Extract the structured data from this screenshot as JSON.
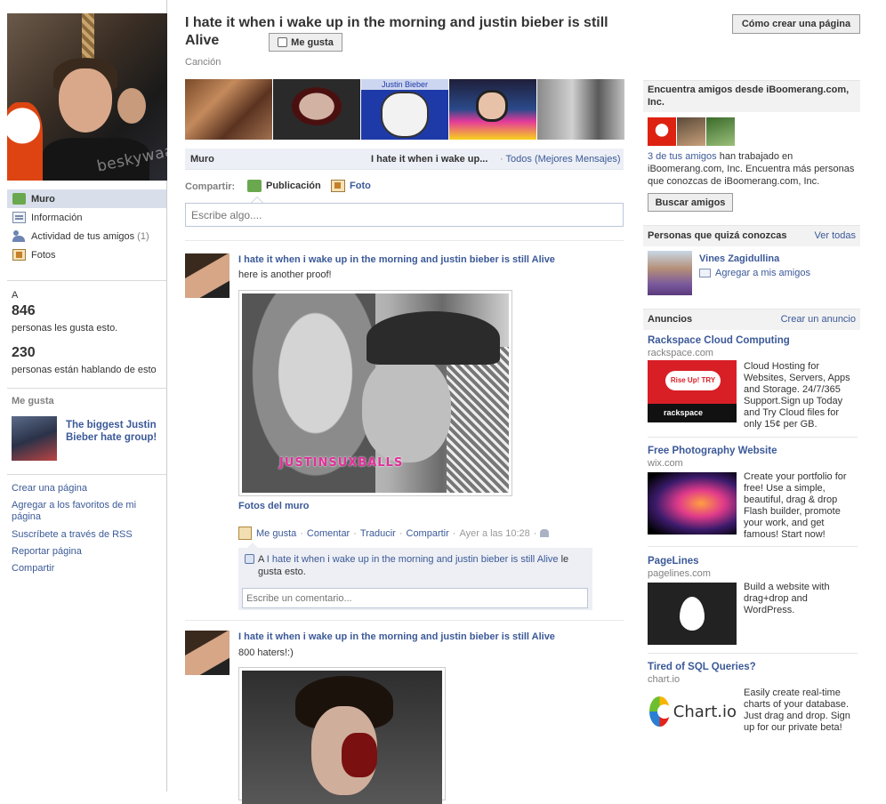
{
  "page": {
    "title": "I hate it when i wake up in the morning and justin bieber is still Alive",
    "like_button": "Me gusta",
    "category": "Canción",
    "create_page_button": "Cómo crear una página",
    "profile_watermark": "beskywaabbit"
  },
  "left_nav": {
    "items": [
      {
        "label": "Muro",
        "icon": "wall-icon",
        "active": true
      },
      {
        "label": "Información",
        "icon": "info-icon"
      },
      {
        "label": "Actividad de tus amigos",
        "count": "(1)",
        "icon": "friends-icon"
      },
      {
        "label": "Fotos",
        "icon": "photos-icon"
      }
    ]
  },
  "stats": {
    "prefix": "A",
    "likes_count": "846",
    "likes_label": "personas les gusta esto.",
    "talking_count": "230",
    "talking_label": "personas están hablando de esto"
  },
  "likes_section": {
    "title": "Me gusta",
    "item_name": "The biggest Justin Bieber hate group!"
  },
  "side_links": [
    "Crear una página",
    "Agregar a los favoritos de mi página",
    "Suscríbete a través de RSS",
    "Reportar página",
    "Compartir"
  ],
  "photo_strip": {
    "center_caption": "Justin Bieber"
  },
  "wall_tabs": {
    "muro": "Muro",
    "filter_title": "I hate it when i wake up...",
    "filter_sep": "·",
    "filter_links": "Todos (Mejores Mensajes)"
  },
  "composer": {
    "share_label": "Compartir:",
    "publication": "Publicación",
    "photo": "Foto",
    "placeholder": "Escribe algo...."
  },
  "posts": [
    {
      "author": "I hate it when i wake up in the morning and justin bieber is still Alive",
      "text": "here is another proof!",
      "photo_watermark": "JUSTINSUXBALLS",
      "album_link": "Fotos del muro",
      "actions": {
        "like": "Me gusta",
        "comment": "Comentar",
        "translate": "Traducir",
        "share": "Compartir",
        "time": "Ayer a las 10:28",
        "sep": "·"
      },
      "likes_prefix": "A",
      "likes_link": "I hate it when i wake up in the morning and justin bieber is still Alive",
      "likes_suffix": "le gusta esto.",
      "comment_placeholder": "Escribe un comentario..."
    },
    {
      "author": "I hate it when i wake up in the morning and justin bieber is still Alive",
      "text": "800 haters!:)"
    }
  ],
  "right": {
    "find_friends": {
      "title": "Encuentra amigos desde iBoomerang.com, Inc.",
      "desc_link": "3 de tus amigos",
      "desc_rest": "han trabajado en iBoomerang.com, Inc. Encuentra más personas que conozcas de iBoomerang.com, Inc.",
      "button": "Buscar amigos"
    },
    "pymk": {
      "title": "Personas que quizá conozcas",
      "see_all": "Ver todas",
      "name": "Vines Zagidullina",
      "add": "Agregar a mis amigos"
    },
    "ads": {
      "title": "Anuncios",
      "create": "Crear un anuncio",
      "items": [
        {
          "title": "Rackspace Cloud Computing",
          "domain": "rackspace.com",
          "body": "Cloud Hosting for Websites, Servers, Apps and Storage. 24/7/365 Support.Sign up Today and Try Cloud files for only 15¢ per GB.",
          "img_text1": "Rise Up! TRY TODAY!",
          "img_text2": "rackspace"
        },
        {
          "title": "Free Photography Website",
          "domain": "wix.com",
          "body": "Create your portfolio for free! Use a simple, beautiful, drag & drop Flash builder, promote your work, and get famous! Start now!"
        },
        {
          "title": "PageLines",
          "domain": "pagelines.com",
          "body": "Build a website with drag+drop and WordPress."
        },
        {
          "title": "Tired of SQL Queries?",
          "domain": "chart.io",
          "body": "Easily create real-time charts of your database. Just drag and drop. Sign up for our private beta!",
          "img_text": "Chart.io"
        }
      ]
    }
  }
}
